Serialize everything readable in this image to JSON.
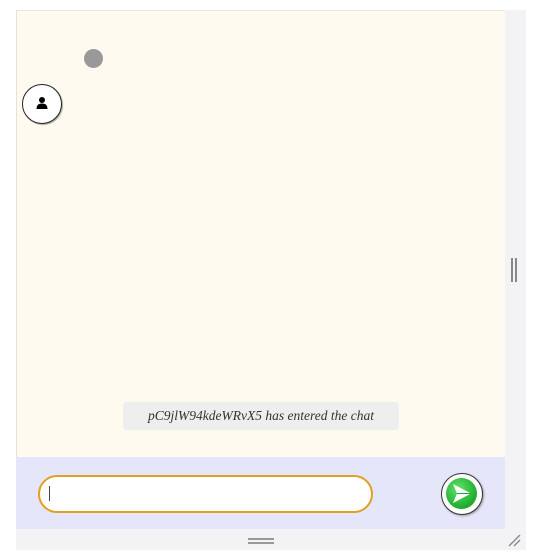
{
  "chat": {
    "system_message": "pC9jlW94kdeWRvX5 has entered the chat"
  },
  "composer": {
    "input_value": "",
    "placeholder": ""
  },
  "icons": {
    "avatar": "user-icon",
    "send": "send-arrow-icon",
    "typing": "typing-indicator-dot"
  },
  "colors": {
    "chat_background": "#fffaf0",
    "input_bar_background": "#e6e6fa",
    "input_border": "#e0a020",
    "send_button_green": "#2ecc40",
    "system_message_background": "#eeeeee"
  }
}
